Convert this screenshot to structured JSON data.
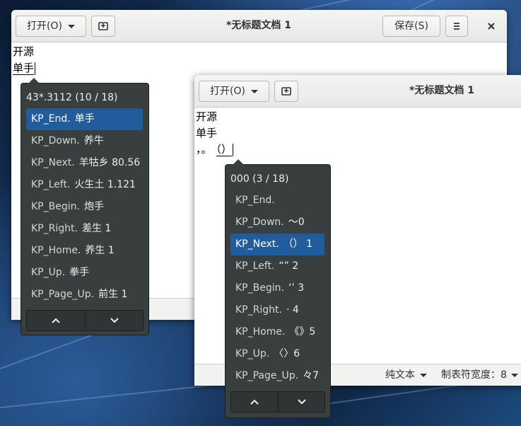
{
  "window1": {
    "open_label": "打开(O)",
    "save_label": "保存(S)",
    "title": "*无标题文档 1",
    "lines": [
      "开源",
      "单手"
    ]
  },
  "popup1": {
    "header": "43*.3112 (10 / 18)",
    "items": [
      {
        "key": "KP_End.",
        "value": "单手"
      },
      {
        "key": "KP_Down.",
        "value": "养牛"
      },
      {
        "key": "KP_Next.",
        "value": "羊牯乡 80.56"
      },
      {
        "key": "KP_Left.",
        "value": "火生土 1.121"
      },
      {
        "key": "KP_Begin.",
        "value": "炮手"
      },
      {
        "key": "KP_Right.",
        "value": "差生 1"
      },
      {
        "key": "KP_Home.",
        "value": "养生 1"
      },
      {
        "key": "KP_Up.",
        "value": "拳手"
      },
      {
        "key": "KP_Page_Up.",
        "value": "前生 1"
      }
    ],
    "selected": 0
  },
  "window2": {
    "open_label": "打开(O)",
    "title": "*无标题文档 1",
    "lines": [
      "开源",
      "单手"
    ],
    "preedit_prefix": "，。",
    "preedit": "（）",
    "status_lang": "纯文本",
    "status_tab": "制表符宽度：8"
  },
  "popup2": {
    "header": "000 (3 / 18)",
    "items": [
      {
        "key": "KP_End.",
        "value": ""
      },
      {
        "key": "KP_Down.",
        "value": "～0"
      },
      {
        "key": "KP_Next.",
        "value": "（） 1"
      },
      {
        "key": "KP_Left.",
        "value": "“” 2"
      },
      {
        "key": "KP_Begin.",
        "value": "‘’ 3"
      },
      {
        "key": "KP_Right.",
        "value": "· 4"
      },
      {
        "key": "KP_Home.",
        "value": "《》5"
      },
      {
        "key": "KP_Up.",
        "value": "〈〉6"
      },
      {
        "key": "KP_Page_Up.",
        "value": "々7"
      }
    ],
    "selected": 2
  },
  "colors": {
    "popup_bg": "#393f3f",
    "selection": "#215d9c",
    "headerbar": "#ececea"
  }
}
